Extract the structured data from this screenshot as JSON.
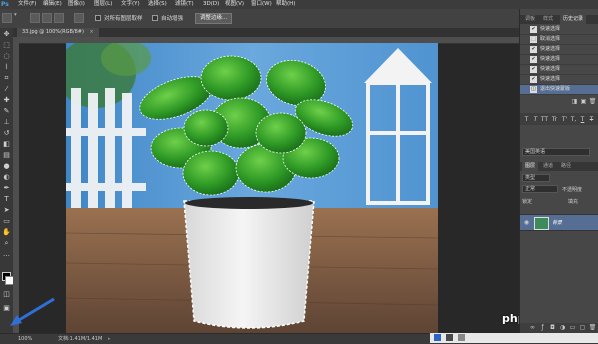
{
  "menubar": {
    "logo": "Ps",
    "items": [
      "文件(F)",
      "编辑(E)",
      "图像(I)",
      "图层(L)",
      "文字(Y)",
      "选择(S)",
      "滤镜(T)",
      "3D(D)",
      "视图(V)",
      "窗口(W)",
      "帮助(H)"
    ]
  },
  "options": {
    "sample_all_label": "对所有图层取样",
    "auto_enhance_label": "自动增强",
    "refine_edge_label": "调整边缘..."
  },
  "document": {
    "tab_title": "33.jpg @ 100%(RGB/8#)",
    "zoom": "100%",
    "doc_info": "文档:1.41M/1.41M"
  },
  "history_panel": {
    "tabs": [
      "调板",
      "样式",
      "历史记录"
    ],
    "active_tab": "历史记录",
    "items": [
      {
        "label": "快速选择",
        "selected": false
      },
      {
        "label": "取消选择",
        "selected": false
      },
      {
        "label": "快速选择",
        "selected": false
      },
      {
        "label": "快速选择",
        "selected": false
      },
      {
        "label": "快速选择",
        "selected": false
      },
      {
        "label": "快速选择",
        "selected": false
      },
      {
        "label": "退出快速蒙版",
        "selected": true
      }
    ]
  },
  "char_panel": {
    "glyphs": [
      "T",
      "T",
      "TT",
      "Tr",
      "T'",
      "T,",
      "T",
      "T"
    ],
    "language": "美国英语"
  },
  "layers_panel": {
    "tabs": [
      "图层",
      "通道",
      "路径"
    ],
    "active_tab": "图层",
    "kind_label": "类型",
    "blend_mode": "正常",
    "opacity_label": "不透明度",
    "lock_label": "锁定",
    "fill_label": "填充",
    "layer_name": "背景"
  },
  "watermark": "php 中文网",
  "colors": {
    "accent_selection": "#576e94",
    "arrow": "#2f6fd6"
  }
}
